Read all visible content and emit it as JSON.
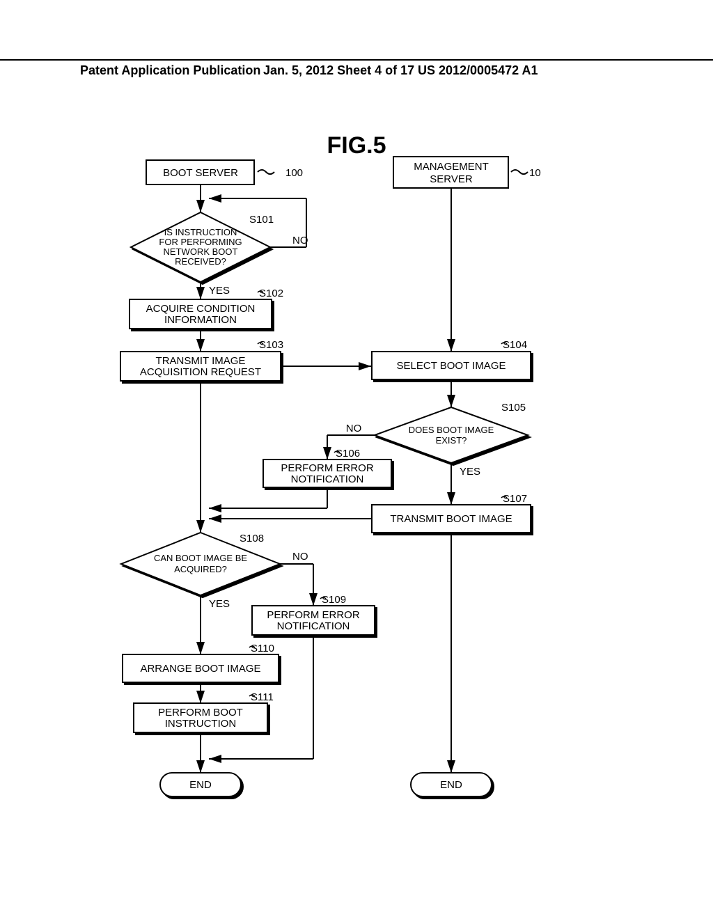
{
  "header": {
    "left": "Patent Application Publication",
    "mid": "Jan. 5, 2012   Sheet 4 of 17",
    "right": "US 2012/0005472 A1"
  },
  "fig_title": "FIG.5",
  "labels": {
    "boot_server": "BOOT SERVER",
    "mgmt_server_l1": "MANAGEMENT",
    "mgmt_server_l2": "SERVER",
    "ref100": "100",
    "ref10": "10",
    "yes": "YES",
    "no": "NO",
    "end": "END",
    "s101": "S101",
    "s102": "S102",
    "s103": "S103",
    "s104": "S104",
    "s105": "S105",
    "s106": "S106",
    "s107": "S107",
    "s108": "S108",
    "s109": "S109",
    "s110": "S110",
    "s111": "S111",
    "q101_l1": "IS INSTRUCTION",
    "q101_l2": "FOR PERFORMING",
    "q101_l3": "NETWORK BOOT",
    "q101_l4": "RECEIVED?",
    "p102_l1": "ACQUIRE CONDITION",
    "p102_l2": "INFORMATION",
    "p103_l1": "TRANSMIT IMAGE",
    "p103_l2": "ACQUISITION REQUEST",
    "p104": "SELECT BOOT IMAGE",
    "q105_l1": "DOES BOOT IMAGE",
    "q105_l2": "EXIST?",
    "p106_l1": "PERFORM ERROR",
    "p106_l2": "NOTIFICATION",
    "p107": "TRANSMIT BOOT IMAGE",
    "q108_l1": "CAN BOOT IMAGE BE",
    "q108_l2": "ACQUIRED?",
    "p109_l1": "PERFORM ERROR",
    "p109_l2": "NOTIFICATION",
    "p110": "ARRANGE BOOT IMAGE",
    "p111_l1": "PERFORM BOOT",
    "p111_l2": "INSTRUCTION"
  }
}
